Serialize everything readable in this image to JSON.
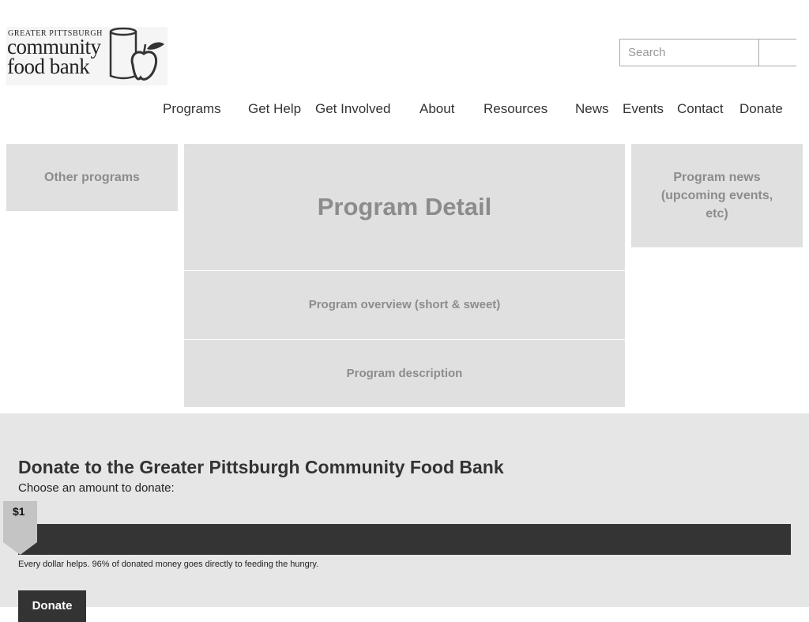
{
  "logo": {
    "line1": "GREATER PITTSBURGH",
    "line2": "community",
    "line3": "food bank",
    "icon": "can-and-apple-icon"
  },
  "search": {
    "placeholder": "Search",
    "button_icon": "search-icon"
  },
  "nav": [
    {
      "label": "Programs"
    },
    {
      "label": "Get Help"
    },
    {
      "label": "Get Involved"
    },
    {
      "label": "About"
    },
    {
      "label": "Resources"
    },
    {
      "label": "News"
    },
    {
      "label": "Events"
    },
    {
      "label": "Contact"
    },
    {
      "label": "Donate"
    }
  ],
  "main": {
    "other_programs": "Other programs",
    "program_detail": "Program Detail",
    "program_news": "Program news (upcoming events, etc)",
    "program_overview": "Program overview (short & sweet)",
    "program_description": "Program description"
  },
  "donate": {
    "title": "Donate to the Greater Pittsburgh Community Food Bank",
    "subtitle": "Choose an amount to donate:",
    "amount_label": "$1",
    "slider_value_fraction": 0,
    "note": "Every dollar helps. 96% of donated money goes directly to feeding the hungry.",
    "button_label": "Donate"
  },
  "colors": {
    "block_bg": "#e0e0e0",
    "block_text": "#8c8c8c",
    "donate_bg": "#e6e6e6",
    "track": "#343434"
  }
}
